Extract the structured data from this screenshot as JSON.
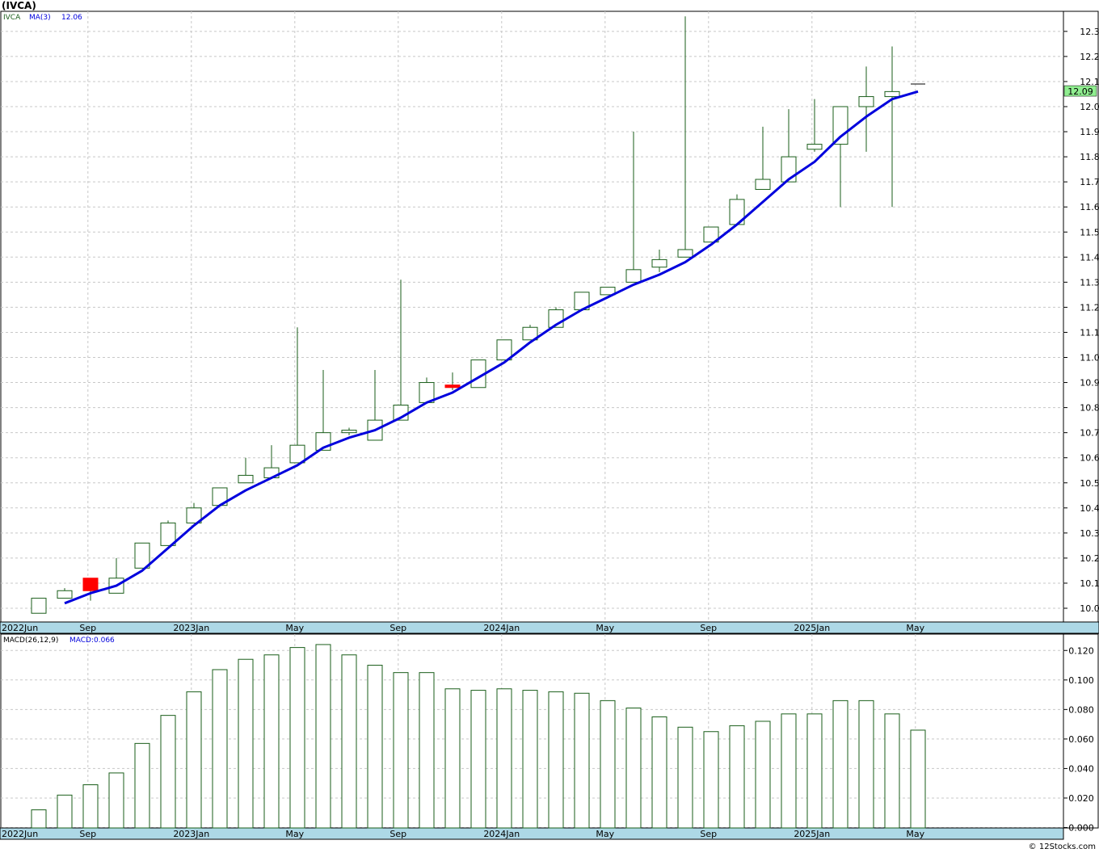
{
  "header": {
    "title": "(IVCA)"
  },
  "footer": {
    "credit": "© 12Stocks.com"
  },
  "colors": {
    "up_candle": "#1a5e1a",
    "down_candle": "#ff0000",
    "ma_line": "#0000dd",
    "macd_bar": "#1a5e1a",
    "last_price_bg": "#90ee90",
    "grid": "#c8c8c8",
    "axis_band": "#add8e6"
  },
  "chart_data": [
    {
      "type": "candlestick",
      "legend": {
        "symbol": "IVCA",
        "ma_label": "MA(3)",
        "ma_value": "12.06"
      },
      "last_price_label": "12.09",
      "y_ticks": [
        "10.00",
        "10.10",
        "10.20",
        "10.30",
        "10.40",
        "10.50",
        "10.60",
        "10.70",
        "10.80",
        "10.90",
        "11.00",
        "11.10",
        "11.20",
        "11.30",
        "11.40",
        "11.50",
        "11.60",
        "11.70",
        "11.80",
        "11.90",
        "12.00",
        "12.10",
        "12.20",
        "12.30"
      ],
      "ylim": [
        9.93,
        12.41
      ],
      "x_labels": [
        {
          "label": "2022Jun",
          "index": -1.25
        },
        {
          "label": "Sep",
          "index": 1.9
        },
        {
          "label": "2023Jan",
          "index": 5.9
        },
        {
          "label": "May",
          "index": 9.9
        },
        {
          "label": "Sep",
          "index": 13.9
        },
        {
          "label": "2024Jan",
          "index": 17.9
        },
        {
          "label": "May",
          "index": 21.9
        },
        {
          "label": "Sep",
          "index": 25.9
        },
        {
          "label": "2025Jan",
          "index": 29.9
        },
        {
          "label": "May",
          "index": 33.9
        }
      ],
      "candles": [
        {
          "o": 9.98,
          "h": 10.04,
          "l": 9.98,
          "c": 10.04
        },
        {
          "o": 10.04,
          "h": 10.08,
          "l": 10.04,
          "c": 10.07
        },
        {
          "o": 10.12,
          "h": 10.12,
          "l": 10.03,
          "c": 10.07
        },
        {
          "o": 10.06,
          "h": 10.2,
          "l": 10.06,
          "c": 10.12
        },
        {
          "o": 10.16,
          "h": 10.26,
          "l": 10.16,
          "c": 10.26
        },
        {
          "o": 10.25,
          "h": 10.35,
          "l": 10.25,
          "c": 10.34
        },
        {
          "o": 10.34,
          "h": 10.42,
          "l": 10.34,
          "c": 10.4
        },
        {
          "o": 10.41,
          "h": 10.48,
          "l": 10.41,
          "c": 10.48
        },
        {
          "o": 10.5,
          "h": 10.6,
          "l": 10.5,
          "c": 10.53
        },
        {
          "o": 10.52,
          "h": 10.65,
          "l": 10.52,
          "c": 10.56
        },
        {
          "o": 10.58,
          "h": 11.12,
          "l": 10.58,
          "c": 10.65
        },
        {
          "o": 10.63,
          "h": 10.95,
          "l": 10.63,
          "c": 10.7
        },
        {
          "o": 10.7,
          "h": 10.72,
          "l": 10.69,
          "c": 10.71
        },
        {
          "o": 10.67,
          "h": 10.95,
          "l": 10.67,
          "c": 10.75
        },
        {
          "o": 10.75,
          "h": 11.31,
          "l": 10.75,
          "c": 10.81
        },
        {
          "o": 10.82,
          "h": 10.92,
          "l": 10.82,
          "c": 10.9
        },
        {
          "o": 10.89,
          "h": 10.94,
          "l": 10.87,
          "c": 10.88
        },
        {
          "o": 10.88,
          "h": 10.99,
          "l": 10.88,
          "c": 10.99
        },
        {
          "o": 10.99,
          "h": 11.07,
          "l": 10.99,
          "c": 11.07
        },
        {
          "o": 11.07,
          "h": 11.13,
          "l": 11.07,
          "c": 11.12
        },
        {
          "o": 11.12,
          "h": 11.2,
          "l": 11.12,
          "c": 11.19
        },
        {
          "o": 11.19,
          "h": 11.26,
          "l": 11.19,
          "c": 11.26
        },
        {
          "o": 11.25,
          "h": 11.28,
          "l": 11.25,
          "c": 11.28
        },
        {
          "o": 11.3,
          "h": 11.9,
          "l": 11.3,
          "c": 11.35
        },
        {
          "o": 11.36,
          "h": 11.43,
          "l": 11.34,
          "c": 11.39
        },
        {
          "o": 11.4,
          "h": 12.36,
          "l": 11.4,
          "c": 11.43
        },
        {
          "o": 11.46,
          "h": 11.52,
          "l": 11.46,
          "c": 11.52
        },
        {
          "o": 11.53,
          "h": 11.65,
          "l": 11.53,
          "c": 11.63
        },
        {
          "o": 11.67,
          "h": 11.92,
          "l": 11.67,
          "c": 11.71
        },
        {
          "o": 11.7,
          "h": 11.99,
          "l": 11.7,
          "c": 11.8
        },
        {
          "o": 11.83,
          "h": 12.03,
          "l": 11.82,
          "c": 11.85
        },
        {
          "o": 11.85,
          "h": 12.0,
          "l": 11.6,
          "c": 12.0
        },
        {
          "o": 12.0,
          "h": 12.16,
          "l": 11.82,
          "c": 12.04
        },
        {
          "o": 12.04,
          "h": 12.24,
          "l": 11.6,
          "c": 12.06
        },
        {
          "o": 12.09,
          "h": 12.09,
          "l": 12.09,
          "c": 12.09
        }
      ],
      "ma": [
        null,
        10.02,
        10.06,
        10.09,
        10.15,
        10.24,
        10.33,
        10.41,
        10.47,
        10.52,
        10.57,
        10.64,
        10.68,
        10.71,
        10.76,
        10.82,
        10.86,
        10.92,
        10.98,
        11.06,
        11.13,
        11.19,
        11.24,
        11.29,
        11.33,
        11.38,
        11.45,
        11.53,
        11.62,
        11.71,
        11.78,
        11.88,
        11.96,
        12.03,
        12.06
      ]
    },
    {
      "type": "bar",
      "legend": {
        "label": "MACD(26,12,9)",
        "value_label": "MACD:0.066"
      },
      "y_ticks": [
        "0.000",
        "0.020",
        "0.040",
        "0.060",
        "0.080",
        "0.100",
        "0.120"
      ],
      "ylim": [
        0,
        0.124
      ],
      "x_labels": [
        {
          "label": "2022Jun",
          "index": -1.25
        },
        {
          "label": "Sep",
          "index": 1.9
        },
        {
          "label": "2023Jan",
          "index": 5.9
        },
        {
          "label": "May",
          "index": 9.9
        },
        {
          "label": "Sep",
          "index": 13.9
        },
        {
          "label": "2024Jan",
          "index": 17.9
        },
        {
          "label": "May",
          "index": 21.9
        },
        {
          "label": "Sep",
          "index": 25.9
        },
        {
          "label": "2025Jan",
          "index": 29.9
        },
        {
          "label": "May",
          "index": 33.9
        }
      ],
      "values": [
        0.012,
        0.022,
        0.029,
        0.037,
        0.057,
        0.076,
        0.092,
        0.107,
        0.114,
        0.117,
        0.122,
        0.124,
        0.117,
        0.11,
        0.105,
        0.105,
        0.094,
        0.093,
        0.094,
        0.093,
        0.092,
        0.091,
        0.086,
        0.081,
        0.075,
        0.068,
        0.065,
        0.069,
        0.072,
        0.077,
        0.077,
        0.086,
        0.086,
        0.077,
        0.066
      ]
    }
  ]
}
